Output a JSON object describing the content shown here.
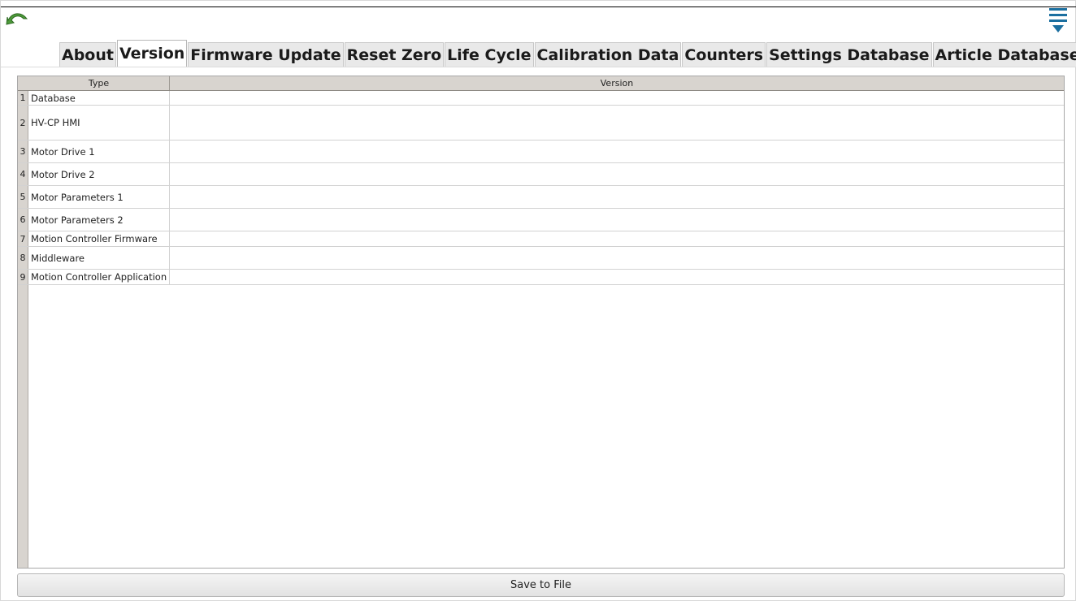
{
  "toolbar": {
    "back_icon": "back-arrow-icon",
    "menu_icon": "filter-menu-icon",
    "accent_color": "#1b6fa0",
    "back_color": "#4e9a3a"
  },
  "tabs": [
    {
      "label": "About",
      "active": false
    },
    {
      "label": "Version",
      "active": true
    },
    {
      "label": "Firmware Update",
      "active": false
    },
    {
      "label": "Reset Zero",
      "active": false
    },
    {
      "label": "Life Cycle",
      "active": false
    },
    {
      "label": "Calibration Data",
      "active": false
    },
    {
      "label": "Counters",
      "active": false
    },
    {
      "label": "Settings Database",
      "active": false
    },
    {
      "label": "Article Database",
      "active": false
    }
  ],
  "table": {
    "columns": [
      "Type",
      "Version"
    ],
    "rows": [
      {
        "num": "1",
        "type": "Database",
        "version": ""
      },
      {
        "num": "2",
        "type": "HV-CP HMI",
        "version": ""
      },
      {
        "num": "3",
        "type": "Motor Drive 1",
        "version": ""
      },
      {
        "num": "4",
        "type": "Motor Drive 2",
        "version": ""
      },
      {
        "num": "5",
        "type": "Motor Parameters 1",
        "version": ""
      },
      {
        "num": "6",
        "type": "Motor Parameters 2",
        "version": ""
      },
      {
        "num": "7",
        "type": "Motion Controller Firmware",
        "version": ""
      },
      {
        "num": "8",
        "type": "Middleware",
        "version": ""
      },
      {
        "num": "9",
        "type": "Motion Controller Application",
        "version": ""
      }
    ]
  },
  "footer": {
    "save_label": "Save to File"
  }
}
